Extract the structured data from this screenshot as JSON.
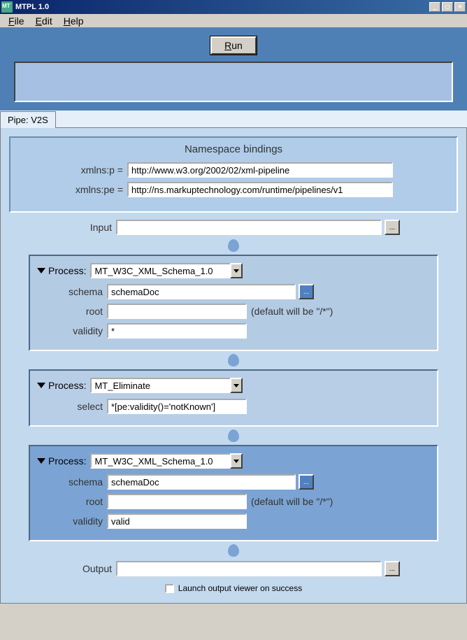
{
  "window": {
    "title": "MTPL 1.0"
  },
  "menu": {
    "file": "File",
    "edit": "Edit",
    "help": "Help"
  },
  "toolbar": {
    "run": "Run"
  },
  "tab": {
    "label": "Pipe: V2S"
  },
  "ns": {
    "heading": "Namespace bindings",
    "label_p": "xmlns:p =",
    "value_p": "http://www.w3.org/2002/02/xml-pipeline",
    "label_pe": "xmlns:pe =",
    "value_pe": "http://ns.markuptechnology.com/runtime/pipelines/v1"
  },
  "input": {
    "label": "Input",
    "value": "",
    "browse": "..."
  },
  "output": {
    "label": "Output",
    "value": "",
    "browse": "..."
  },
  "proc1": {
    "label": "Process:",
    "type": "MT_W3C_XML_Schema_1.0",
    "schema_label": "schema",
    "schema_value": "schemaDoc",
    "schema_browse": "...",
    "root_label": "root",
    "root_value": "",
    "root_hint": "(default will be \"/*\")",
    "validity_label": "validity",
    "validity_value": "*"
  },
  "proc2": {
    "label": "Process:",
    "type": "MT_Eliminate",
    "select_label": "select",
    "select_value": "*[pe:validity()='notKnown']"
  },
  "proc3": {
    "label": "Process:",
    "type": "MT_W3C_XML_Schema_1.0",
    "schema_label": "schema",
    "schema_value": "schemaDoc",
    "schema_browse": "...",
    "root_label": "root",
    "root_value": "",
    "root_hint": "(default will be \"/*\")",
    "validity_label": "validity",
    "validity_value": "valid"
  },
  "footer": {
    "launch_label": "Launch output viewer on success"
  }
}
